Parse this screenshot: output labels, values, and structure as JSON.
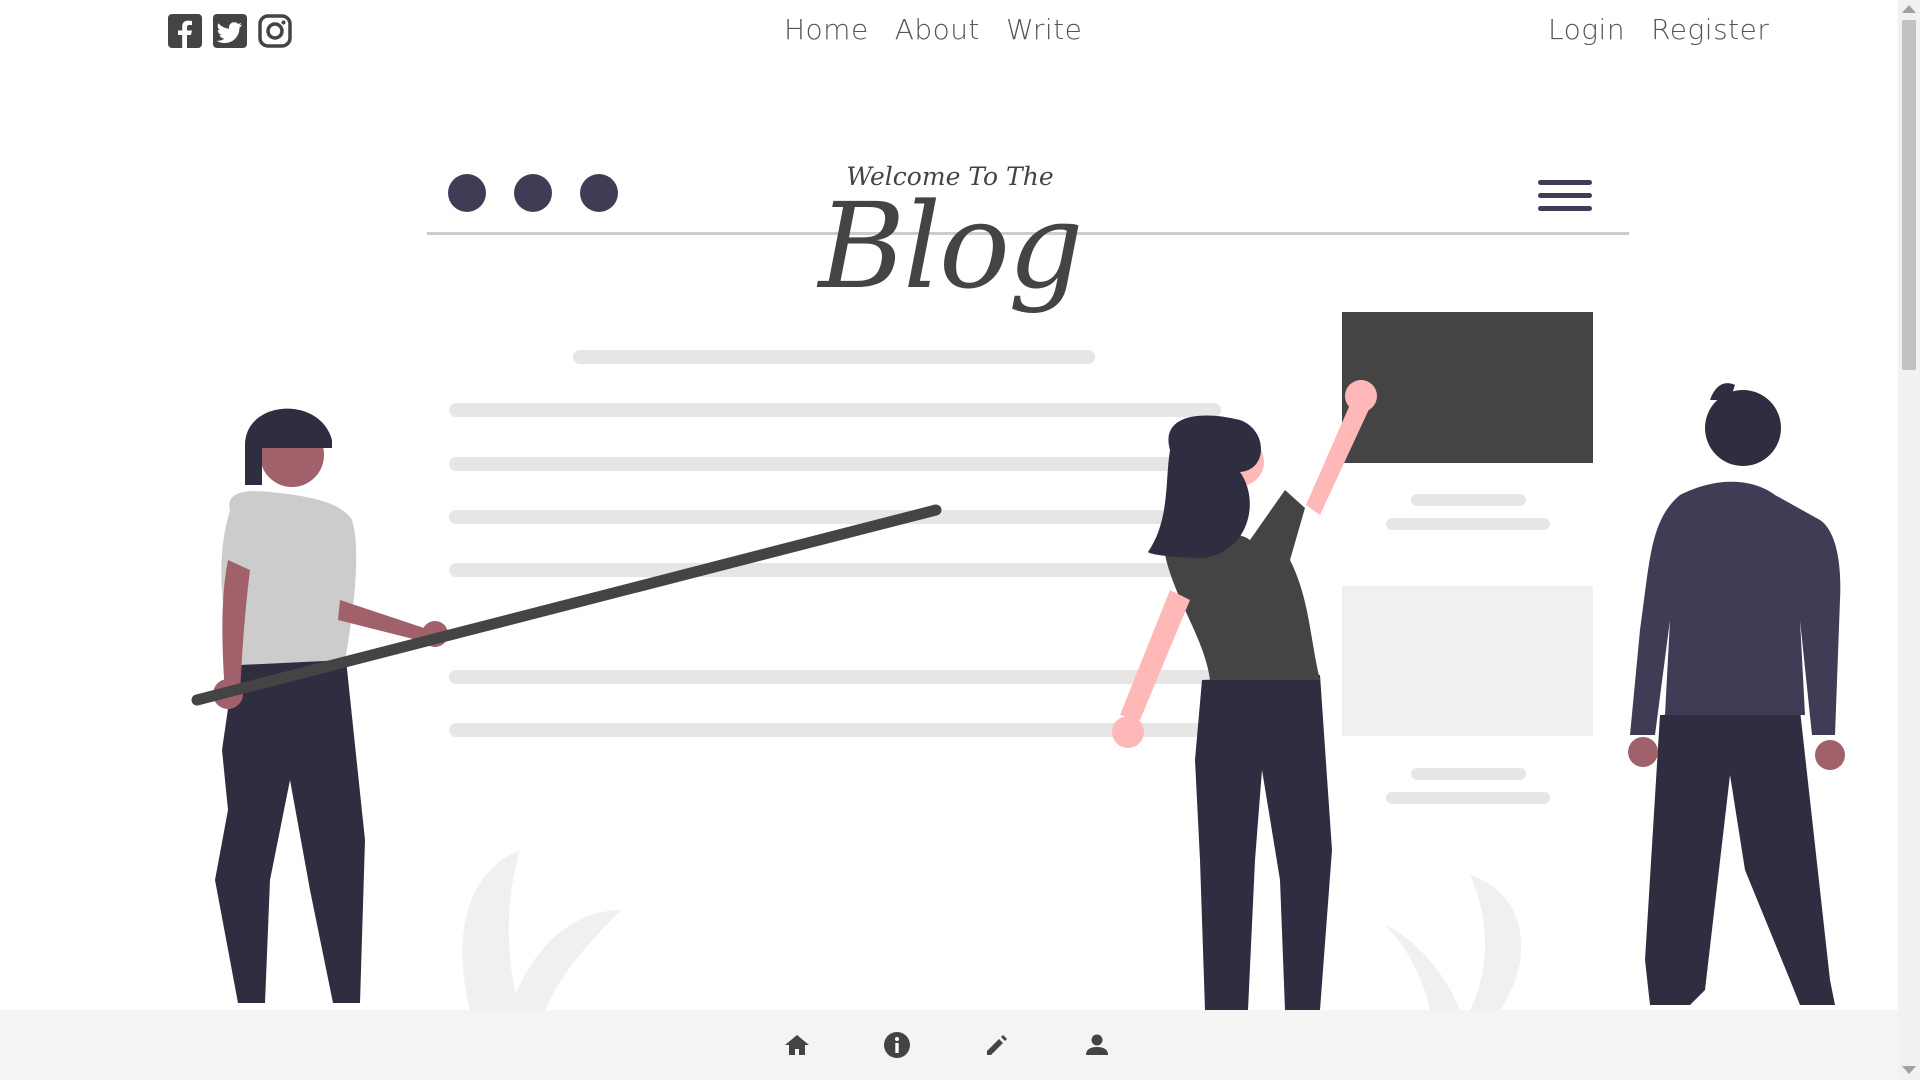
{
  "nav": {
    "social": [
      {
        "icon": "facebook-icon"
      },
      {
        "icon": "twitter-icon"
      },
      {
        "icon": "instagram-icon"
      }
    ],
    "center_links": [
      "Home",
      "About",
      "Write"
    ],
    "right_links": [
      "Login",
      "Register"
    ]
  },
  "hero": {
    "subtitle": "Welcome To The",
    "title": "Blog"
  },
  "bottom_nav": {
    "icons": [
      "home-icon",
      "info-icon",
      "pencil-icon",
      "user-icon"
    ]
  },
  "colors": {
    "text": "#555555",
    "dark": "#3f3d56",
    "panel": "#444444",
    "skin_dark": "#a0616a",
    "skin_light": "#ffb8b8",
    "bottom_bar": "#f3f4f4"
  }
}
